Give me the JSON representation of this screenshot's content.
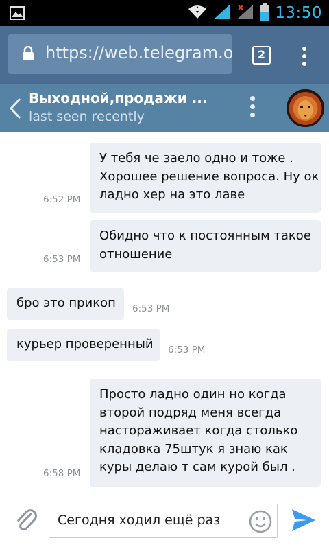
{
  "status_bar": {
    "time": "13:50",
    "icons": [
      "image-notification-icon",
      "wifi-icon",
      "signal-icon",
      "no-signal-icon",
      "battery-icon"
    ]
  },
  "browser": {
    "url": "https://web.telegram.org",
    "tab_count": "2",
    "icons": [
      "lock-icon",
      "overflow-menu-icon"
    ]
  },
  "chat_header": {
    "title": "Выходной,продажи ...",
    "status": "last seen recently",
    "icons": [
      "back-arrow-icon",
      "more-vert-icon"
    ]
  },
  "messages": [
    {
      "direction": "out",
      "lines": [
        "У тебя че заело одно и тоже .",
        "Хорошее решение вопроса. Ну ок",
        "ладно хер на это лаве"
      ],
      "time": "6:52 PM"
    },
    {
      "direction": "out",
      "lines": [
        "Обидно что к постоянным такое",
        "отношение"
      ],
      "time": "6:53 PM"
    },
    {
      "direction": "in",
      "lines": [
        "бро это прикоп"
      ],
      "time": "6:53 PM"
    },
    {
      "direction": "in",
      "lines": [
        "курьер проверенный"
      ],
      "time": "6:53 PM"
    },
    {
      "direction": "out",
      "lines": [
        "Просто ладно один но когда",
        "второй подряд меня всегда",
        "настораживает когда столько",
        "кладовка 75штук я знаю как",
        "куры делаю т сам курой был  ."
      ],
      "time": "6:58 PM"
    }
  ],
  "composer": {
    "input_value": "Сегодня ходил ещё раз",
    "icons": [
      "paperclip-icon",
      "smiley-icon",
      "send-icon"
    ]
  },
  "colors": {
    "browser_bar": "#4a6d91",
    "url_box": "#6789ac",
    "chat_header": "#5682a3",
    "bubble": "#eceff3",
    "send_accent": "#3a9cf0",
    "status_accent": "#33b5e5"
  }
}
